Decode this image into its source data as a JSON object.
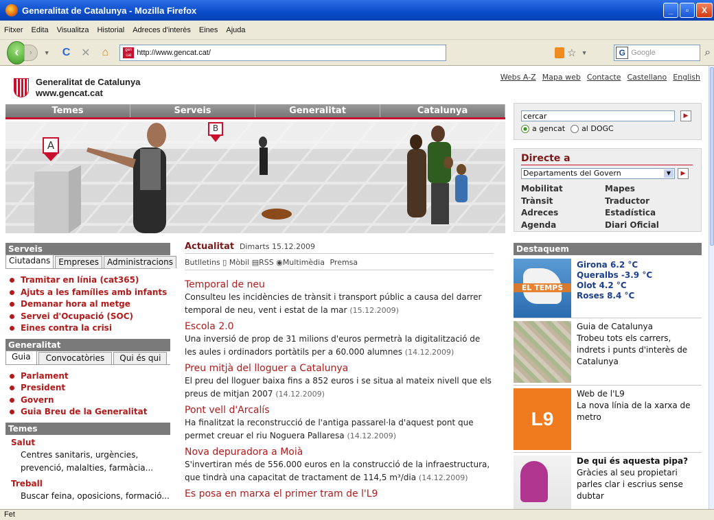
{
  "window": {
    "title": "Generalitat de Catalunya - Mozilla Firefox",
    "min": "_",
    "max": "▫",
    "close": "X"
  },
  "menu": [
    "Fitxer",
    "Edita",
    "Visualitza",
    "Historial",
    "Adreces d'interès",
    "Eines",
    "Ajuda"
  ],
  "nav": {
    "url": "http://www.gencat.cat/",
    "search_placeholder": "Google",
    "favicon_text": "gen cat"
  },
  "status": "Fet",
  "site": {
    "name": "Generalitat de Catalunya",
    "domain": "www.gencat.cat"
  },
  "toplinks": [
    "Webs A-Z",
    "Mapa web",
    "Contacte",
    "Castellano",
    "English"
  ],
  "maintabs": [
    "Temes",
    "Serveis",
    "Generalitat",
    "Catalunya"
  ],
  "hero": {
    "marker_a": "A",
    "marker_b": "B"
  },
  "serveis": {
    "title": "Serveis",
    "tabs": [
      "Ciutadans",
      "Empreses",
      "Administracions"
    ],
    "items": [
      "Tramitar en línia (cat365)",
      "Ajuts a les famílies amb infants",
      "Demanar hora al metge",
      "Servei d'Ocupació (SOC)",
      "Eines contra la crisi"
    ]
  },
  "generalitat": {
    "title": "Generalitat",
    "tabs": [
      "Guia",
      "Convocatòries",
      "Qui és qui"
    ],
    "items": [
      "Parlament",
      "President",
      "Govern",
      "Guia Breu de la Generalitat"
    ]
  },
  "temes": {
    "title": "Temes",
    "items": [
      {
        "h": "Salut",
        "d": "Centres sanitaris, urgències, prevenció, malalties, farmàcia..."
      },
      {
        "h": "Treball",
        "d": "Buscar feina, oposicions, formació..."
      }
    ]
  },
  "actualitat": {
    "title": "Actualitat",
    "date": "Dimarts 15.12.2009",
    "links": [
      "Butlletins",
      "Mòbil",
      "RSS",
      "Multimèdia",
      "Premsa"
    ],
    "news": [
      {
        "t": "Temporal de neu",
        "p": "Consulteu les incidències de trànsit i transport públic a causa del darrer temporal de neu, vent i estat de la mar",
        "d": "(15.12.2009)"
      },
      {
        "t": "Escola 2.0",
        "p": "Una inversió de prop de 31 milions d'euros permetrà la digitalització de les aules i ordinadors portàtils per a 60.000 alumnes",
        "d": "(14.12.2009)"
      },
      {
        "t": "Preu mitjà del lloguer a Catalunya",
        "p": "El preu del lloguer baixa fins a 852 euros i se situa al mateix nivell que els preus de mitjan 2007",
        "d": "(14.12.2009)"
      },
      {
        "t": "Pont vell d'Arcalís",
        "p": "Ha finalitzat la reconstrucció de l'antiga passarel·la d'aquest pont que permet creuar el riu Noguera Pallaresa",
        "d": "(14.12.2009)"
      },
      {
        "t": "Nova depuradora a Moià",
        "p": "S'invertiran més de 556.000 euros en la construcció de la infraestructura, que tindrà una capacitat de tractament de 114,5 m³/dia",
        "d": "(14.12.2009)"
      },
      {
        "t": "Es posa en marxa el primer tram de l'L9",
        "p": "",
        "d": ""
      }
    ]
  },
  "search": {
    "value": "cercar",
    "opt1": "a gencat",
    "opt2": "al DOGC"
  },
  "directe": {
    "title": "Directe a",
    "select": "Departaments del Govern",
    "links": [
      "Mobilitat",
      "Mapes",
      "Trànsit",
      "Traductor",
      "Adreces",
      "Estadística",
      "Agenda",
      "Diari Oficial"
    ]
  },
  "destaquem": {
    "title": "Destaquem",
    "temps": {
      "img_label": "EL TEMPS",
      "lines": [
        "Girona 6.2 °C",
        "Queralbs -3.9 °C",
        "Olot 4.2 °C",
        "Roses 8.4 °C"
      ]
    },
    "guia": {
      "t": "Guia de Catalunya",
      "p": "Trobeu tots els carrers, indrets i punts d'interès de Catalunya"
    },
    "l9": {
      "img_label": "L9",
      "t": "Web de l'L9",
      "p": "La nova línia de la xarxa de metro"
    },
    "pipa": {
      "t": "De qui és aquesta pipa?",
      "p": "Gràcies al seu propietari parles clar i escrius sense dubtar"
    }
  },
  "colors": {
    "brand_red": "#c8102e",
    "link_red": "#b31b1b",
    "tab_gray": "#7a7a7a"
  }
}
